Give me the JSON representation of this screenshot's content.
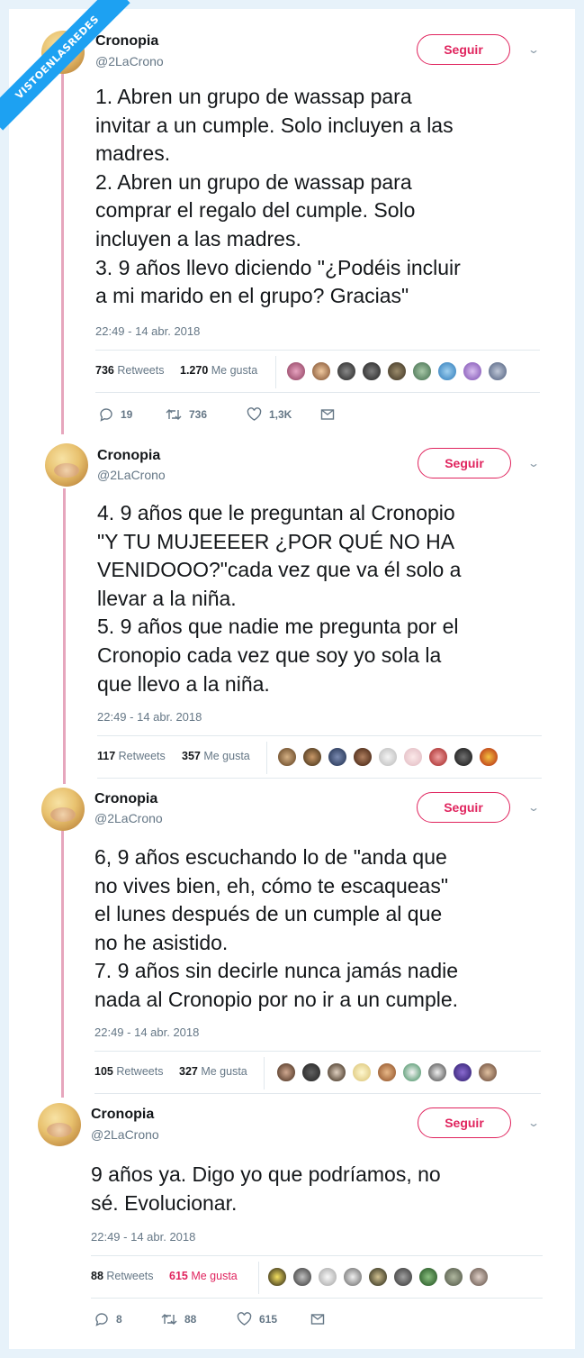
{
  "watermark": "VISTOENLASREDES",
  "follow_label": "Seguir",
  "colors": {
    "follow": "#e0245e",
    "thread": "#e6a6bd",
    "link": "#1da1f2"
  },
  "tweets": [
    {
      "name": "Cronopia",
      "handle": "@2LaCrono",
      "text": "1. Abren un grupo de wassap para\ninvitar a un cumple. Solo incluyen a las\nmadres.\n2. Abren un grupo de wassap para\ncomprar el regalo del cumple. Solo\nincluyen a las madres.\n3. 9 años llevo diciendo \"¿Podéis incluir\na mi marido en el grupo? Gracias\"",
      "time": "22:49 - 14 abr. 2018",
      "retweets": "736",
      "retweets_label": "Retweets",
      "likes": "1.270",
      "likes_label": "Me gusta",
      "replies": "19",
      "rt_count": "736",
      "like_count": "1,3K"
    },
    {
      "name": "Cronopia",
      "handle": "@2LaCrono",
      "text": "4. 9 años que le preguntan al Cronopio\n\"Y TU MUJEEEER ¿POR QUÉ NO HA\nVENIDOOO?\"cada vez que va él solo a\nllevar a la niña.\n5. 9 años que nadie me pregunta por el\nCronopio cada vez que soy yo sola la\nque llevo a la niña.",
      "time": "22:49 - 14 abr. 2018",
      "retweets": "117",
      "retweets_label": "Retweets",
      "likes": "357",
      "likes_label": "Me gusta"
    },
    {
      "name": "Cronopia",
      "handle": "@2LaCrono",
      "text": "6, 9 años escuchando lo de \"anda que\nno vives bien, eh, cómo te escaqueas\"\nel lunes después de un cumple al que\nno he asistido.\n7. 9 años sin decirle nunca jamás nadie\nnada al Cronopio por no ir a un cumple.",
      "time": "22:49 - 14 abr. 2018",
      "retweets": "105",
      "retweets_label": "Retweets",
      "likes": "327",
      "likes_label": "Me gusta"
    },
    {
      "name": "Cronopia",
      "handle": "@2LaCrono",
      "text": "9 años ya. Digo yo que podríamos, no\nsé. Evolucionar.",
      "time": "22:49 - 14 abr. 2018",
      "retweets": "88",
      "retweets_label": "Retweets",
      "likes": "615",
      "likes_label": "Me gusta",
      "replies": "8",
      "rt_count": "88",
      "like_count": "615"
    }
  ]
}
